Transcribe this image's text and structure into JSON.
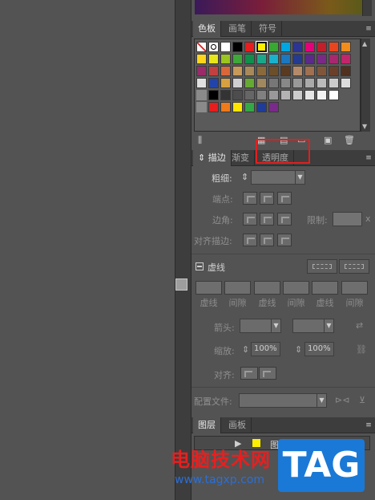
{
  "swatches_panel": {
    "tabs": [
      {
        "label": "色板",
        "active": true
      },
      {
        "label": "画笔",
        "active": false
      },
      {
        "label": "符号",
        "active": false
      }
    ],
    "row1": [
      "none",
      "register",
      "#ffffff",
      "#000000",
      "#e81d1d",
      "#ffee00",
      "#38a832",
      "#00a6e0",
      "#2c3494",
      "#e5007a",
      "#c21f2a",
      "#e8451f",
      "#f28c1c"
    ],
    "row2": [
      "#ffd51c",
      "#e6e61a",
      "#9bc51f",
      "#3ea838",
      "#0e8f4a",
      "#1aa88a",
      "#1ab1cc",
      "#1a77c0",
      "#243b8f",
      "#5b2a8a",
      "#7a2a86",
      "#a8276f",
      "#c2256a"
    ],
    "row3": [
      "#9a2a6a",
      "#c24040",
      "#d9673a",
      "#c79a5a",
      "#a88a5a",
      "#8a6a3a",
      "#6b4e2a",
      "#5a3a20",
      "#b58a6a",
      "#a07050",
      "#80563a",
      "#6a402a",
      "#50301e"
    ],
    "row4": [
      "#e0e0e0",
      "#2244aa",
      "#d8a040",
      "#d0d0d0",
      "#66aa33",
      "#a08860",
      "#777",
      "#888",
      "#999",
      "#aaa",
      "#bbb",
      "#ccc",
      "#ddd"
    ],
    "row5": [
      "#000000",
      "#333333",
      "#4d4d4d",
      "#666666",
      "#808080",
      "#999999",
      "#b3b3b3",
      "#cccccc",
      "#e6e6e6",
      "#f2f2f2",
      "#ffffff"
    ],
    "row6": [
      "#e81d1d",
      "#ee7a1a",
      "#ffe600",
      "#34a844",
      "#1f3c9a",
      "#7a2a8a"
    ]
  },
  "stroke_panel": {
    "tabs": [
      {
        "label": "描边",
        "active": true
      },
      {
        "label": "渐变",
        "active": false
      },
      {
        "label": "透明度",
        "active": false
      }
    ],
    "weight_label": "粗细:",
    "cap_label": "端点:",
    "corner_label": "边角:",
    "limit_label": "限制:",
    "limit_unit": "x",
    "align_label": "对齐描边:",
    "dashed_label": "虚线",
    "dash_labels": [
      "虚线",
      "间隙",
      "虚线",
      "间隙",
      "虚线",
      "间隙"
    ],
    "arrow_label": "箭头:",
    "scale_label": "缩放:",
    "scale_start": "100%",
    "scale_end": "100%",
    "align_arrow_label": "对齐:",
    "profile_label": "配置文件:"
  },
  "layers_panel": {
    "tabs": [
      {
        "label": "图层",
        "active": true
      },
      {
        "label": "画板",
        "active": false
      }
    ],
    "layer_name": "图层"
  },
  "watermark": {
    "site_name": "电脑技术网",
    "url": "www.tagxp.com",
    "badge": "TAG"
  },
  "colors": {
    "highlight_box": "#e02020",
    "panel_bg": "#535353",
    "tab_bar_bg": "#3d3d3d"
  }
}
